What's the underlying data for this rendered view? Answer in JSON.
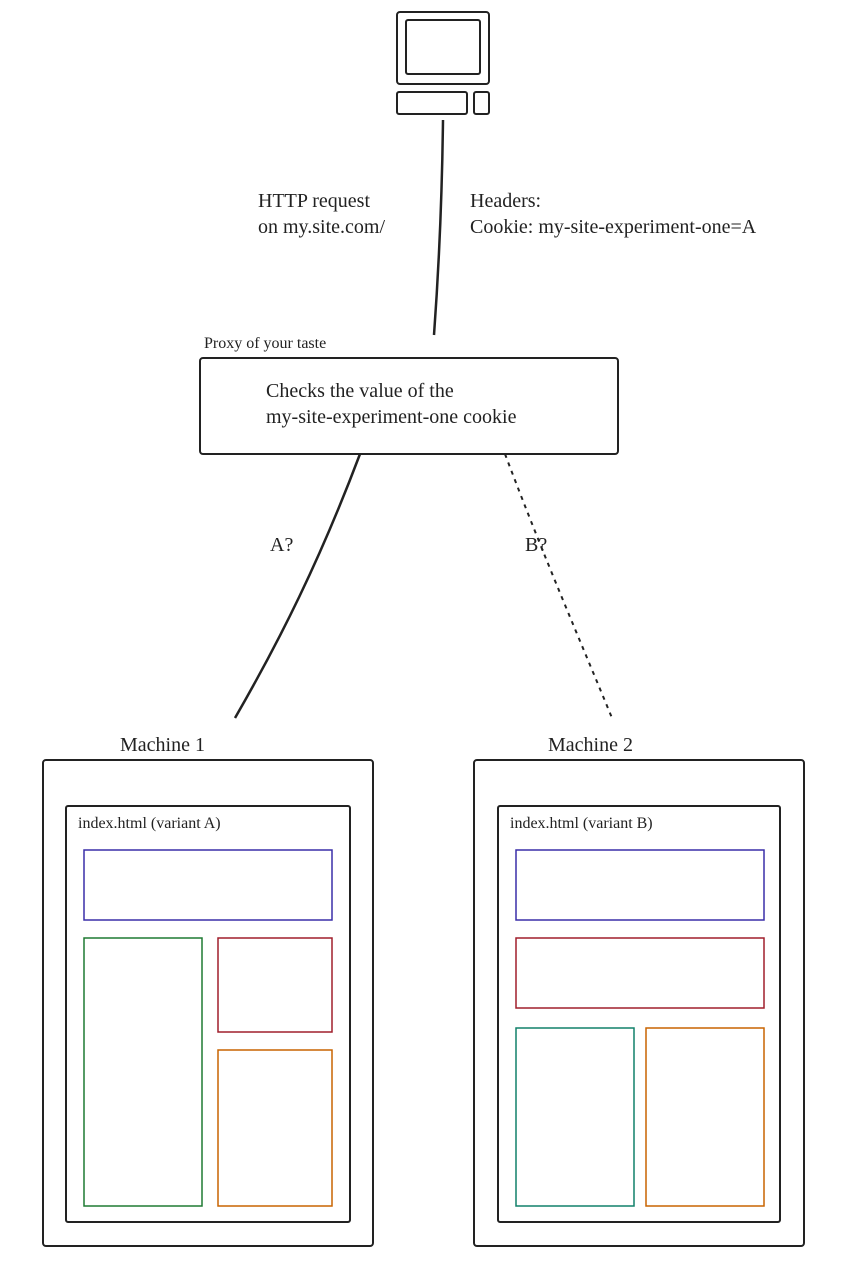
{
  "request": {
    "line1": "HTTP request",
    "line2": "on my.site.com/"
  },
  "headers": {
    "line1": "Headers:",
    "line2": "Cookie: my-site-experiment-one=A"
  },
  "proxy": {
    "title": "Proxy of your taste",
    "body1": "Checks the value of  the",
    "body2": "my-site-experiment-one cookie"
  },
  "branchA": "A?",
  "branchB": "B?",
  "machine1": {
    "title": "Machine 1",
    "page": "index.html (variant A)"
  },
  "machine2": {
    "title": "Machine 2",
    "page": "index.html (variant B)"
  },
  "colors": {
    "purple": "#5a4ed0",
    "green": "#2fb14a",
    "red": "#d83a4a",
    "orange": "#ff8b1f",
    "teal": "#1fb596"
  }
}
